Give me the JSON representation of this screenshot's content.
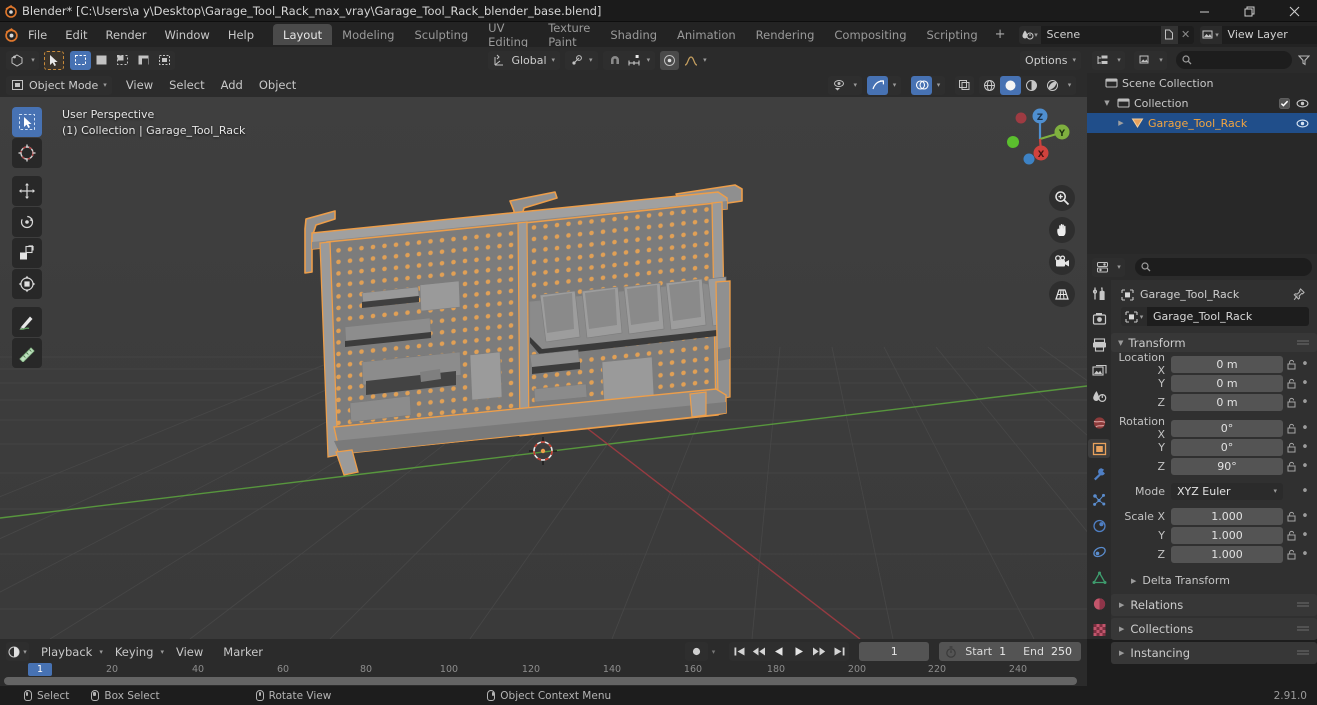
{
  "titlebar": {
    "title": "Blender* [C:\\Users\\a y\\Desktop\\Garage_Tool_Rack_max_vray\\Garage_Tool_Rack_blender_base.blend]",
    "minimize": "—",
    "maximize": "❐",
    "close": "✕"
  },
  "menubar": {
    "items": [
      "File",
      "Edit",
      "Render",
      "Window",
      "Help"
    ],
    "workspaces": [
      {
        "label": "Layout",
        "active": true
      },
      {
        "label": "Modeling",
        "active": false
      },
      {
        "label": "Sculpting",
        "active": false
      },
      {
        "label": "UV Editing",
        "active": false
      },
      {
        "label": "Texture Paint",
        "active": false
      },
      {
        "label": "Shading",
        "active": false
      },
      {
        "label": "Animation",
        "active": false
      },
      {
        "label": "Rendering",
        "active": false
      },
      {
        "label": "Compositing",
        "active": false
      },
      {
        "label": "Scripting",
        "active": false
      }
    ],
    "add_workspace": "+",
    "scene": "Scene",
    "view_layer": "View Layer",
    "new_btn": "⧉",
    "unlink_btn": "✕"
  },
  "viewport_header": {
    "editor_type": "editor-type-3dview",
    "mode": "Object Mode",
    "menus": [
      "View",
      "Select",
      "Add",
      "Object"
    ],
    "transform_orientation": "Global",
    "options": "Options",
    "select_modes": [
      "tweak",
      "box-select",
      "circle-select",
      "lasso-select",
      "select-box-extra"
    ],
    "snap_label": "",
    "proportional": ""
  },
  "viewport": {
    "overlay_line1": "User Perspective",
    "overlay_line2": "(1) Collection | Garage_Tool_Rack",
    "tools": [
      {
        "name": "tweak-tool",
        "active": true
      },
      {
        "name": "cursor-tool",
        "active": false
      },
      {
        "name": "move-tool",
        "active": false
      },
      {
        "name": "rotate-tool",
        "active": false
      },
      {
        "name": "scale-tool",
        "active": false
      },
      {
        "name": "transform-tool",
        "active": false
      },
      {
        "name": "annotate-tool",
        "active": false
      },
      {
        "name": "measure-tool",
        "active": false
      }
    ],
    "gizmo_axes": [
      "Z",
      "Y",
      "X"
    ],
    "nav_buttons": [
      "zoom-icon",
      "pan-hand-icon",
      "camera-icon",
      "perspective-grid-icon"
    ],
    "background": "#3d3d3d",
    "selection_color": "#ed9e4a",
    "object_color": "#9a9a9a"
  },
  "outliner": {
    "search_placeholder": "",
    "display_mode": "View Layer",
    "rows": [
      {
        "label": "Scene Collection",
        "indent": 0,
        "icon": "collection-icon",
        "selected": false,
        "checkbox": false,
        "eye": false,
        "disclosure": ""
      },
      {
        "label": "Collection",
        "indent": 1,
        "icon": "collection-icon",
        "selected": false,
        "checkbox": true,
        "eye": true,
        "disclosure": "▼"
      },
      {
        "label": "Garage_Tool_Rack",
        "indent": 2,
        "icon": "mesh-object-icon",
        "selected": true,
        "checkbox": false,
        "eye": true,
        "disclosure": "▶"
      }
    ]
  },
  "properties": {
    "breadcrumb_object": "Garage_Tool_Rack",
    "object_name": "Garage_Tool_Rack",
    "pin_icon": "pin-icon",
    "tabs": [
      {
        "name": "tool-tab",
        "active": false
      },
      {
        "name": "render-tab",
        "active": false
      },
      {
        "name": "output-tab",
        "active": false
      },
      {
        "name": "view-layer-tab",
        "active": false
      },
      {
        "name": "scene-tab",
        "active": false
      },
      {
        "name": "world-tab",
        "active": false
      },
      {
        "name": "object-tab",
        "active": true
      },
      {
        "name": "modifier-tab",
        "active": false
      },
      {
        "name": "particles-tab",
        "active": false
      },
      {
        "name": "physics-tab",
        "active": false
      },
      {
        "name": "constraints-tab",
        "active": false
      },
      {
        "name": "object-data-tab",
        "active": false
      },
      {
        "name": "material-tab",
        "active": false
      },
      {
        "name": "texture-tab",
        "active": false
      }
    ],
    "transform": {
      "title": "Transform",
      "rows": [
        {
          "label": "Location X",
          "value": "0 m"
        },
        {
          "label": "Y",
          "value": "0 m"
        },
        {
          "label": "Z",
          "value": "0 m"
        },
        {
          "label": "Rotation X",
          "value": "0°"
        },
        {
          "label": "Y",
          "value": "0°"
        },
        {
          "label": "Z",
          "value": "90°"
        }
      ],
      "mode_label": "Mode",
      "mode_value": "XYZ Euler",
      "scale_rows": [
        {
          "label": "Scale X",
          "value": "1.000"
        },
        {
          "label": "Y",
          "value": "1.000"
        },
        {
          "label": "Z",
          "value": "1.000"
        }
      ],
      "delta_transform": "Delta Transform"
    },
    "panels": [
      "Relations",
      "Collections",
      "Instancing"
    ]
  },
  "timeline": {
    "editor_icon": "timeline-icon",
    "menus": [
      "Playback",
      "Keying",
      "View",
      "Marker"
    ],
    "current_frame": "1",
    "start_label": "Start",
    "start_value": "1",
    "end_label": "End",
    "end_value": "250",
    "playhead_frame": "1",
    "ticks": [
      20,
      40,
      60,
      80,
      100,
      120,
      140,
      160,
      180,
      200,
      220,
      240
    ],
    "transport": [
      "jump-start-icon",
      "prev-keyframe-icon",
      "play-reverse-icon",
      "play-icon",
      "next-keyframe-icon",
      "jump-end-icon"
    ],
    "record_icon": "record-icon"
  },
  "statusbar": {
    "items": [
      {
        "mouse": "left",
        "label": "Select"
      },
      {
        "mouse": "left-drag",
        "label": "Box Select"
      },
      {
        "mouse": "middle",
        "label": "Rotate View"
      },
      {
        "mouse": "right",
        "label": "Object Context Menu"
      }
    ],
    "version": "2.91.0"
  }
}
